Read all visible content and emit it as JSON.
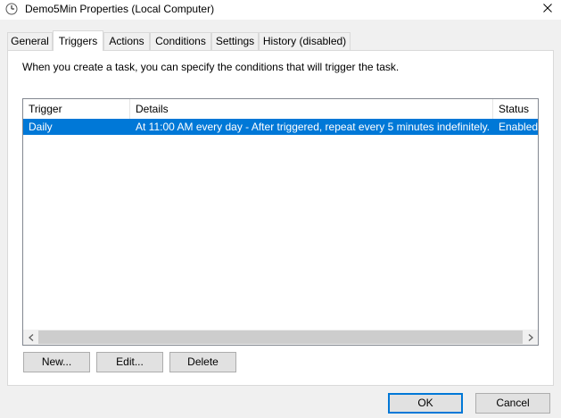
{
  "window": {
    "title": "Demo5Min Properties (Local Computer)",
    "close_icon": "close-icon"
  },
  "tabs": [
    {
      "label": "General",
      "active": false
    },
    {
      "label": "Triggers",
      "active": true
    },
    {
      "label": "Actions",
      "active": false
    },
    {
      "label": "Conditions",
      "active": false
    },
    {
      "label": "Settings",
      "active": false
    },
    {
      "label": "History (disabled)",
      "active": false
    }
  ],
  "triggers_tab": {
    "description": "When you create a task, you can specify the conditions that will trigger the task.",
    "columns": [
      "Trigger",
      "Details",
      "Status"
    ],
    "rows": [
      {
        "trigger": "Daily",
        "details": "At 11:00 AM every day - After triggered, repeat every 5 minutes indefinitely.",
        "status": "Enabled",
        "selected": true
      }
    ],
    "buttons": {
      "new": "New...",
      "edit": "Edit...",
      "delete": "Delete"
    }
  },
  "footer": {
    "ok": "OK",
    "cancel": "Cancel"
  },
  "colors": {
    "selection": "#0078d7",
    "window_bg": "#f0f0f0",
    "panel_bg": "#ffffff"
  }
}
